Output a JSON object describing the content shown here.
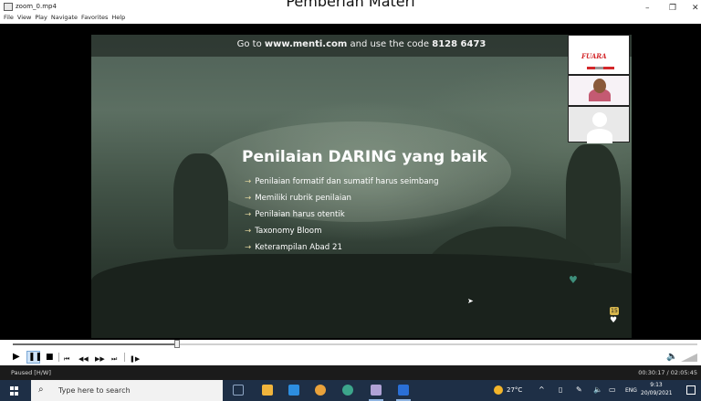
{
  "window": {
    "title": "zoom_0.mp4",
    "overlay_heading": "Pemberian Materi",
    "minimize_glyph": "–",
    "restore_glyph": "❐",
    "close_glyph": "✕"
  },
  "menubar": {
    "items": [
      "File",
      "View",
      "Play",
      "Navigate",
      "Favorites",
      "Help"
    ]
  },
  "slide": {
    "banner_prefix": "Go to ",
    "banner_url": "www.menti.com",
    "banner_middle": " and use the code ",
    "banner_code": "8128 6473",
    "title": "Penilaian DARING yang baik",
    "bullets": [
      "Penilaian formatif dan sumatif harus seimbang",
      "Memiliki rubrik penilaian",
      "Penilaian harus otentik",
      "Taxonomy Bloom",
      "Keterampilan Abad 21"
    ],
    "thumb_logo_text": "FUARA",
    "reaction_count": "15"
  },
  "player": {
    "progress_fraction": 0.24,
    "status": "Paused [H/W]",
    "time": "00:30:17 / 02:05:45",
    "buttons": {
      "play": "▶",
      "pause": "❚❚",
      "stop": "■",
      "prev": "⏮",
      "rewind": "◀◀",
      "forward": "▶▶",
      "next": "⏭",
      "frame": "❚▶",
      "volume": "🔈"
    }
  },
  "taskbar": {
    "search_placeholder": "Type here to search",
    "weather": "27°C",
    "lang": "ENG",
    "clock_time": "9:13",
    "clock_date": "20/09/2021",
    "app_colors": [
      "#8fa6c4",
      "#f0b43c",
      "#2d8ee0",
      "#e9a23b",
      "#3ca58b",
      "#b0a2d6",
      "#2a6fd6"
    ]
  },
  "colors": {
    "accent_arrow": "#e6d9a0",
    "heart": "#3e8f7b",
    "taskbar": "#1e2f46"
  }
}
